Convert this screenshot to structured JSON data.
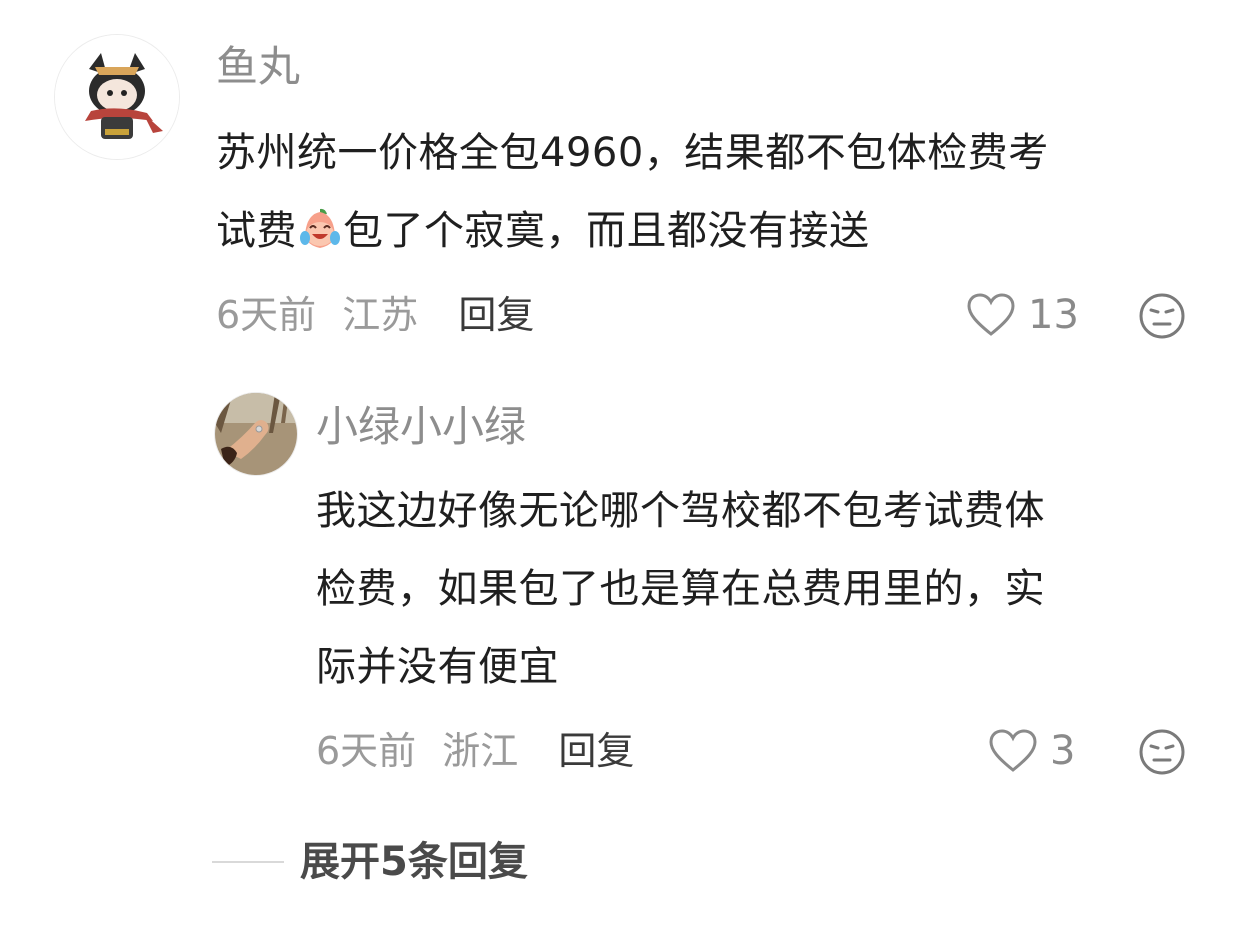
{
  "comment": {
    "username": "鱼丸",
    "text_line1": "苏州统一价格全包4960，结果都不包体检费考",
    "text_line2_prefix": "试费",
    "emoji": "crying-laughing-peach-emoji",
    "text_line2_suffix": "包了个寂寞，而且都没有接送",
    "time": "6天前",
    "location": "江苏",
    "reply_label": "回复",
    "like_count": "13"
  },
  "reply": {
    "username": "小绿小小绿",
    "text_line1": "我这边好像无论哪个驾校都不包考试费体",
    "text_line2": "检费，如果包了也是算在总费用里的，实",
    "text_line3": "际并没有便宜",
    "time": "6天前",
    "location": "浙江",
    "reply_label": "回复",
    "like_count": "3"
  },
  "expand_label": "展开5条回复",
  "icons": {
    "like": "heart-outline-icon",
    "dislike": "neutral-face-icon"
  },
  "colors": {
    "username": "#8d8d8d",
    "meta": "#9a9a9a",
    "body": "#1f1f1f"
  }
}
